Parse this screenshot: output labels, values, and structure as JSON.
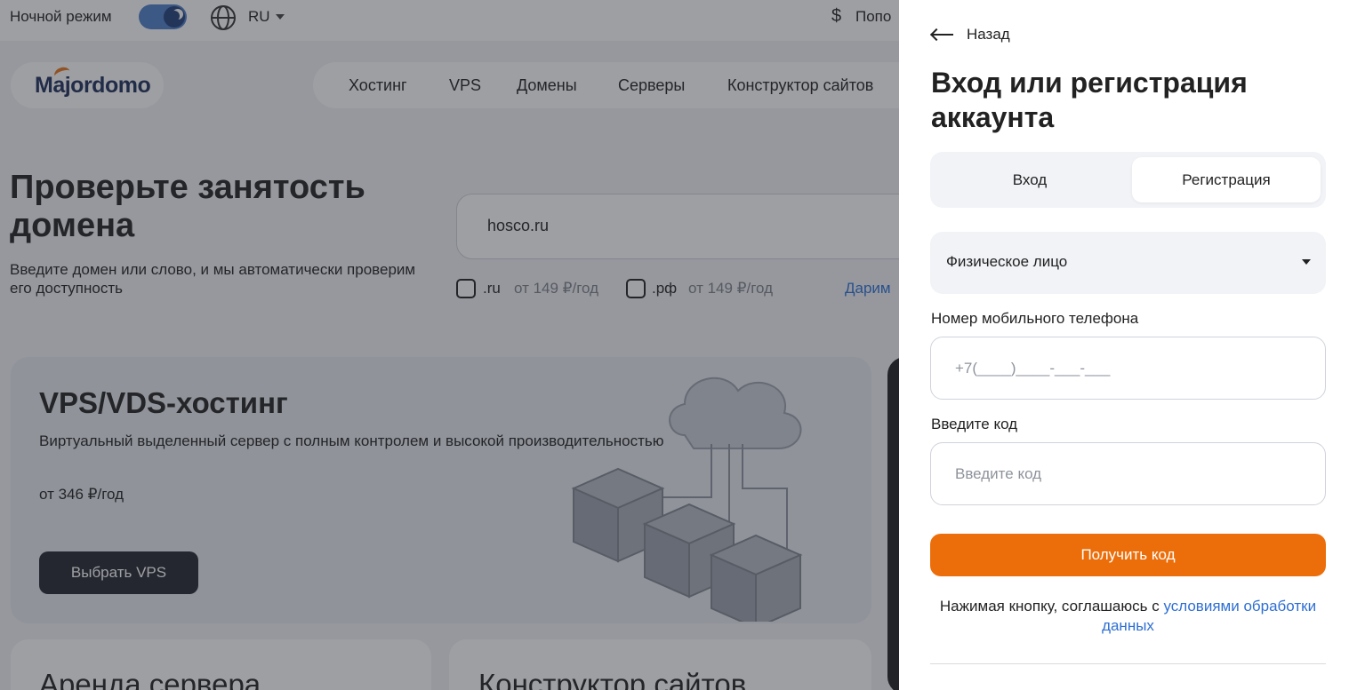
{
  "background": {
    "topbar": {
      "night_mode_label": "Ночной режим",
      "language": "RU",
      "topup_label": "Попо"
    },
    "logo": "Majordomo",
    "nav": [
      "Хостинг",
      "VPS",
      "Домены",
      "Серверы",
      "Конструктор сайтов"
    ],
    "domain_check": {
      "title": "Проверьте занятость домена",
      "subtitle": "Введите домен или слово, и мы автоматически проверим его доступность",
      "input_value": "hosco.ru",
      "options": [
        {
          "zone": ".ru",
          "price": "от 149 ₽/год"
        },
        {
          "zone": ".рф",
          "price": "от 149 ₽/год"
        }
      ],
      "gift_link": "Дарим"
    },
    "vps_card": {
      "title": "VPS/VDS-хостинг",
      "subtitle": "Виртуальный выделенный сервер с полным контролем и высокой производительностью",
      "price": "от 346 ₽/год",
      "button": "Выбрать VPS"
    },
    "bottom_cards": [
      "Аренда сервера",
      "Конструктор сайтов"
    ]
  },
  "panel": {
    "back_label": "Назад",
    "title": "Вход или регистрация аккаунта",
    "tabs": {
      "login": "Вход",
      "register": "Регистрация",
      "active": "register"
    },
    "entity_select": "Физическое лицо",
    "phone": {
      "label": "Номер мобильного телефона",
      "placeholder": "+7(____)____-___-___"
    },
    "code": {
      "label": "Введите код",
      "placeholder": "Введите код"
    },
    "submit": "Получить код",
    "agree_text": "Нажимая кнопку, соглашаюсь с ",
    "agree_link": "условиями обработки данных"
  },
  "colors": {
    "accent": "#ec6e0a",
    "link": "#2e6fd2",
    "toggle": "#4e7ecb"
  }
}
